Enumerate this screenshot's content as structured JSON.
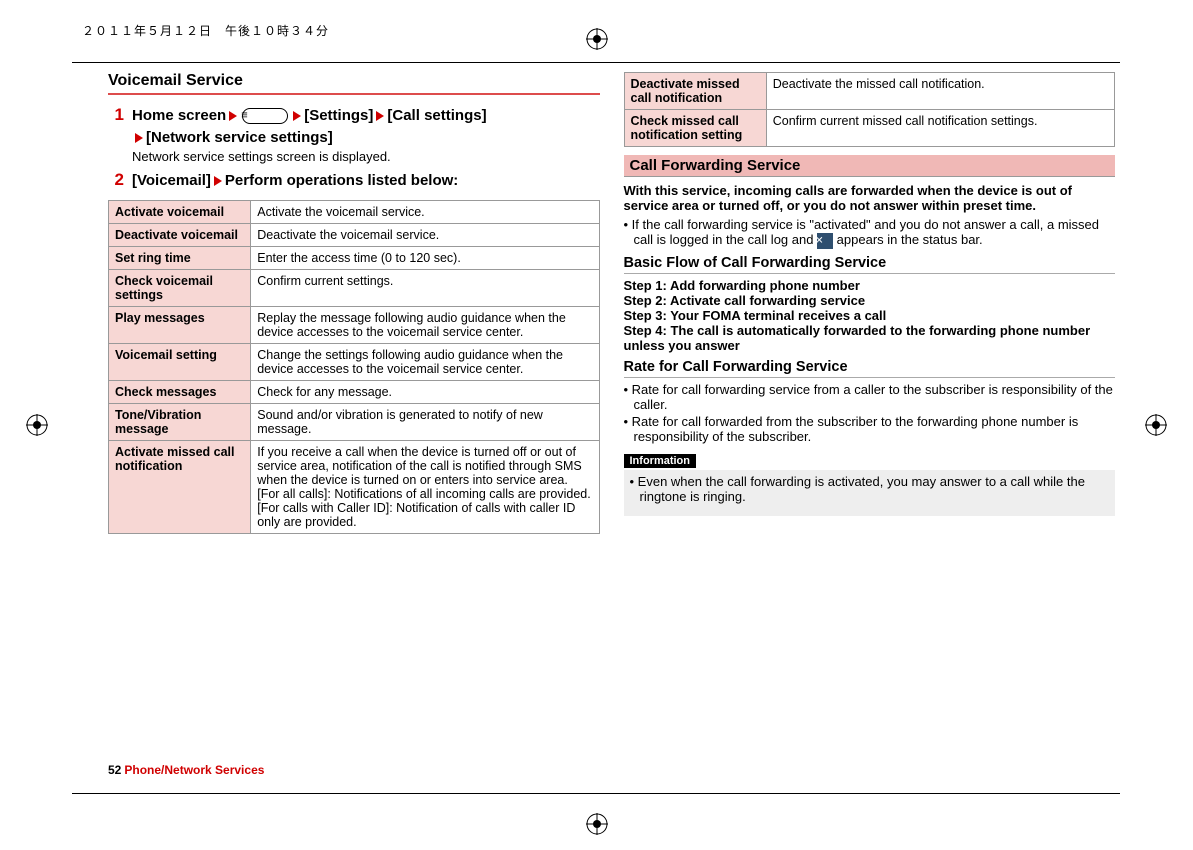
{
  "timestamp": "２０１１年５月１２日　午後１０時３４分",
  "leftCol": {
    "title": "Voicemail Service",
    "step1_pre": "Home screen",
    "step1_b1": "[Settings]",
    "step1_b2": "[Call settings]",
    "step1_b3": "[Network service settings]",
    "step1_sub": "Network service settings screen is displayed.",
    "step2_pre": "[Voicemail]",
    "step2_post": "Perform operations listed below:",
    "rows": [
      {
        "k": "Activate voicemail",
        "v": "Activate the voicemail service."
      },
      {
        "k": "Deactivate voicemail",
        "v": "Deactivate the voicemail service."
      },
      {
        "k": "Set ring time",
        "v": "Enter the access time (0 to 120 sec)."
      },
      {
        "k": "Check voicemail settings",
        "v": "Confirm current settings."
      },
      {
        "k": "Play messages",
        "v": "Replay the message following audio guidance when the device accesses to the voicemail service center."
      },
      {
        "k": "Voicemail setting",
        "v": "Change the settings following audio guidance when the device accesses to the voicemail service center."
      },
      {
        "k": "Check messages",
        "v": "Check for any message."
      },
      {
        "k": "Tone/Vibration message",
        "v": "Sound and/or vibration is generated to notify of new message."
      },
      {
        "k": "Activate missed call notification",
        "v": "If you receive a call when the device is turned off or out of service area, notification of the call is notified through SMS when the device is turned on or enters into service area.\n[For all calls]: Notifications of all incoming calls are provided.\n[For calls with Caller ID]: Notification of calls with caller ID only are provided."
      }
    ]
  },
  "rightCol": {
    "topRows": [
      {
        "k": "Deactivate missed call notification",
        "v": "Deactivate the missed call notification."
      },
      {
        "k": "Check missed call notification setting",
        "v": "Confirm current missed call notification settings."
      }
    ],
    "bandTitle": "Call Forwarding Service",
    "boldPara": "With this service, incoming calls are forwarded when the device is out of service area or turned off, or you do not answer within preset time.",
    "bullet1_pre": "If the call forwarding service is \"activated\" and you do not answer a call, a missed call is logged in the call log and ",
    "bullet1_post": " appears in the status bar.",
    "sub1": "Basic Flow of Call Forwarding Service",
    "steps": [
      "Step 1: Add forwarding phone number",
      "Step 2: Activate call forwarding service",
      "Step 3: Your FOMA terminal receives a call",
      "Step 4: The call is automatically forwarded to the forwarding phone number unless you answer"
    ],
    "sub2": "Rate for Call Forwarding Service",
    "rateBullets": [
      "Rate for call forwarding service from a caller to the subscriber is responsibility of the caller.",
      "Rate for call forwarded from the subscriber to the forwarding phone number is responsibility of the subscriber."
    ],
    "infoTag": "Information",
    "infoBullet": "Even when the call forwarding is activated, you may answer to a call while the ringtone is ringing."
  },
  "footer": {
    "page": "52",
    "section": "Phone/Network Services"
  }
}
